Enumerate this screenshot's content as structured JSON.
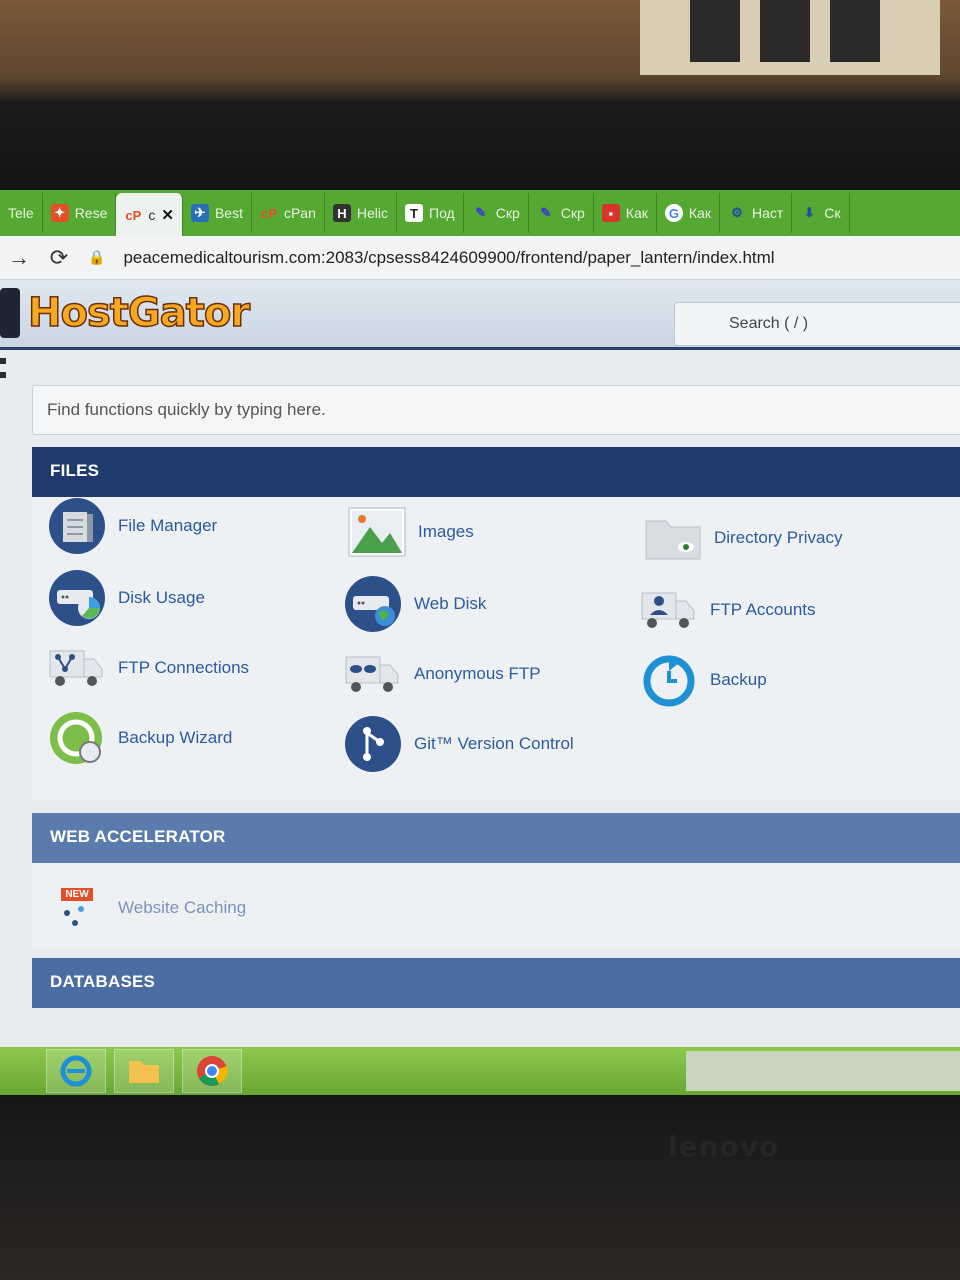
{
  "browser": {
    "tabs": [
      {
        "label": "Tele",
        "icon": "telegram-icon"
      },
      {
        "label": "Rese",
        "icon": "reseller-icon"
      },
      {
        "label": "c",
        "icon": "cpanel-icon",
        "active": true
      },
      {
        "label": "Best",
        "icon": "bird-icon"
      },
      {
        "label": "cPan",
        "icon": "cpanel-icon"
      },
      {
        "label": "Helic",
        "icon": "helicon-icon"
      },
      {
        "label": "Под",
        "icon": "t-icon"
      },
      {
        "label": "Скр",
        "icon": "feather-icon"
      },
      {
        "label": "Скр",
        "icon": "feather-icon"
      },
      {
        "label": "Как",
        "icon": "red-square-icon"
      },
      {
        "label": "Как",
        "icon": "google-icon"
      },
      {
        "label": "Наст",
        "icon": "gear-icon"
      },
      {
        "label": "Ск",
        "icon": "download-icon"
      }
    ],
    "url": "peacemedicaltourism.com:2083/cpsess8424609900/frontend/paper_lantern/index.html"
  },
  "header": {
    "logo": "HostGator",
    "search_placeholder": "Search ( / )"
  },
  "find_placeholder": "Find functions quickly by typing here.",
  "sections": {
    "files": {
      "title": "FILES",
      "items": [
        {
          "label": "File Manager",
          "icon": "file-manager-icon"
        },
        {
          "label": "Images",
          "icon": "images-icon"
        },
        {
          "label": "Directory Privacy",
          "icon": "directory-privacy-icon"
        },
        {
          "label": "Disk Usage",
          "icon": "disk-usage-icon"
        },
        {
          "label": "Web Disk",
          "icon": "web-disk-icon"
        },
        {
          "label": "FTP Accounts",
          "icon": "ftp-accounts-icon"
        },
        {
          "label": "FTP Connections",
          "icon": "ftp-connections-icon"
        },
        {
          "label": "Anonymous FTP",
          "icon": "anonymous-ftp-icon"
        },
        {
          "label": "Backup",
          "icon": "backup-icon"
        },
        {
          "label": "Backup Wizard",
          "icon": "backup-wizard-icon"
        },
        {
          "label": "Git™ Version Control",
          "icon": "git-icon"
        }
      ]
    },
    "web_accelerator": {
      "title": "WEB ACCELERATOR",
      "items": [
        {
          "label": "Website Caching",
          "badge": "NEW",
          "icon": "website-caching-icon"
        }
      ]
    },
    "databases": {
      "title": "DATABASES"
    }
  },
  "colors": {
    "tab_strip": "#55a832",
    "files_header": "#1f3a6b",
    "section_header": "#4b6da3",
    "link": "#2d5a9c",
    "logo": "#f7a823"
  },
  "bezel_brand": "lenovo"
}
